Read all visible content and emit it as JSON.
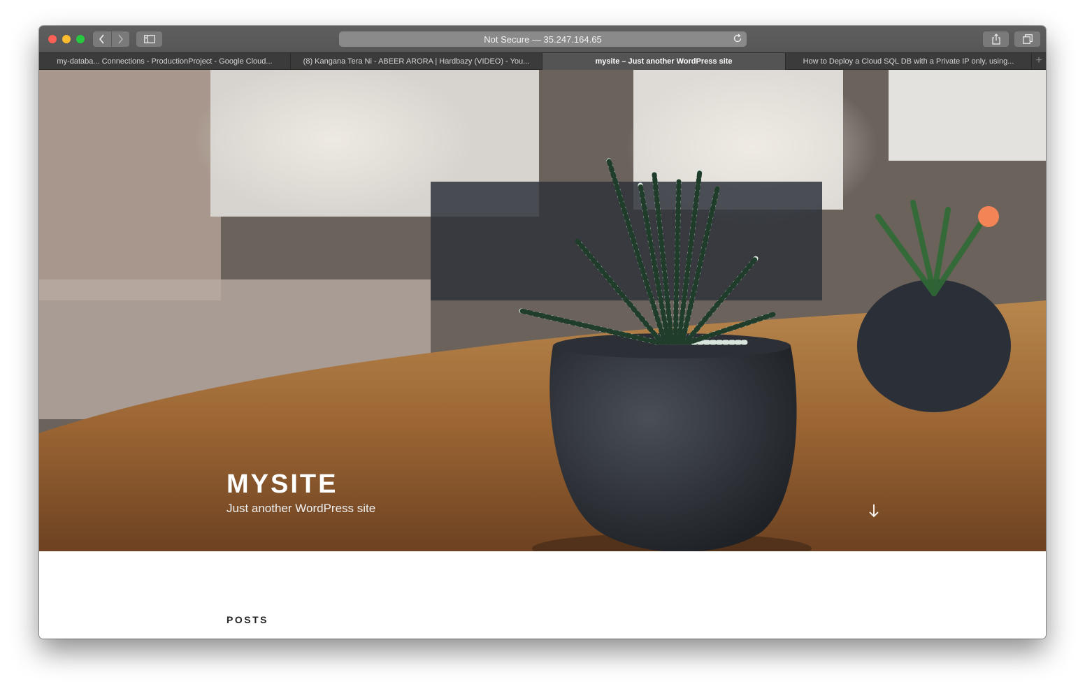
{
  "browser": {
    "address_bar": "Not Secure — 35.247.164.65",
    "tabs": [
      {
        "label": "my-databa... Connections - ProductionProject - Google Cloud...",
        "active": false
      },
      {
        "label": "(8) Kangana Tera Ni - ABEER ARORA | Hardbazy (VIDEO) - You...",
        "active": false
      },
      {
        "label": "mysite – Just another WordPress site",
        "active": true
      },
      {
        "label": "How to Deploy a Cloud SQL DB with a Private IP only, using...",
        "active": false
      }
    ],
    "icons": {
      "back": "chevron-left-icon",
      "forward": "chevron-right-icon",
      "sidebar": "sidebar-icon",
      "reload": "reload-icon",
      "share": "share-icon",
      "tabs": "tab-overview-icon",
      "new_tab": "plus-icon"
    }
  },
  "site": {
    "title": "MYSITE",
    "description": "Just another WordPress site",
    "scroll_icon": "arrow-down-icon"
  },
  "main": {
    "section_heading": "POSTS"
  },
  "colors": {
    "toolbar": "#5a5a5a",
    "tabbar": "#3b3b3b",
    "active_tab": "#545454",
    "hero_text": "#ffffff"
  }
}
